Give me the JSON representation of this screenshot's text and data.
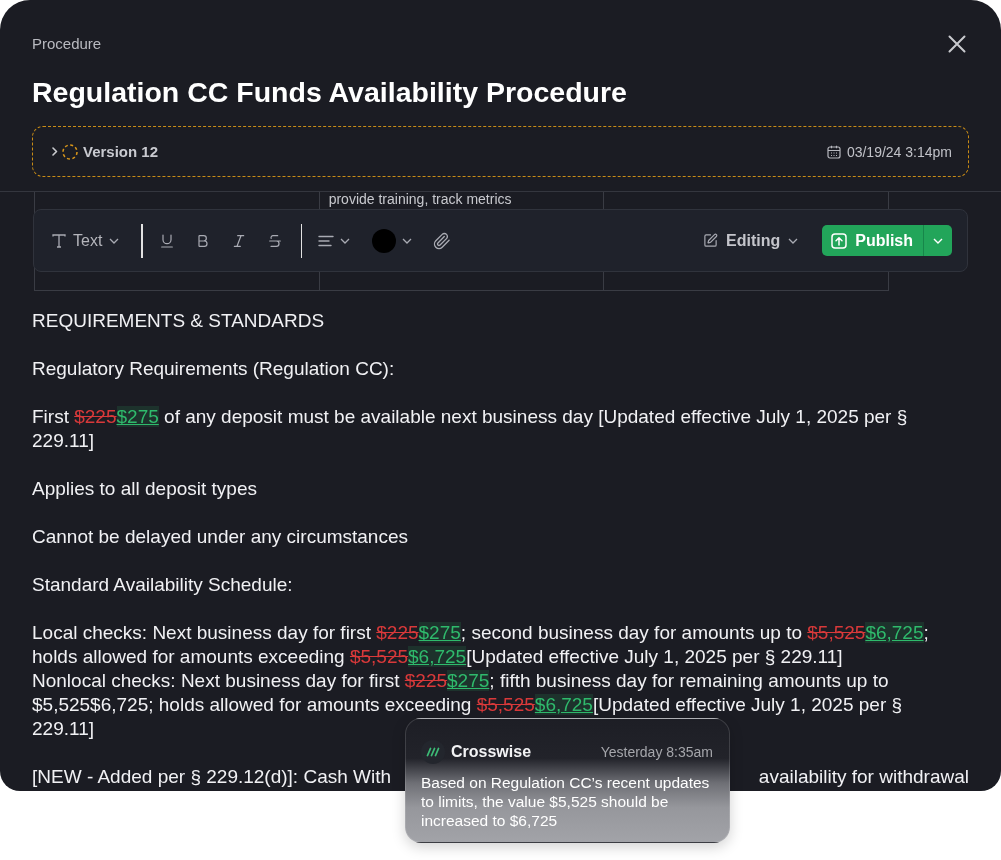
{
  "header": {
    "label": "Procedure",
    "title": "Regulation CC Funds Availability Procedure"
  },
  "version": {
    "label": "Version 12",
    "date": "03/19/24 3:14pm",
    "expanded": false
  },
  "table_fragment": {
    "cell_text": "provide training, track metrics"
  },
  "toolbar": {
    "text_style": "Text",
    "mode": "Editing",
    "publish": "Publish"
  },
  "document": [
    {
      "kind": "block",
      "lines": [
        {
          "segments": [
            {
              "kind": "text",
              "text": "REQUIREMENTS & STANDARDS"
            }
          ]
        }
      ]
    },
    {
      "kind": "block",
      "lines": [
        {
          "segments": [
            {
              "kind": "text",
              "text": "Regulatory Requirements (Regulation CC):"
            }
          ]
        }
      ]
    },
    {
      "kind": "block",
      "lines": [
        {
          "segments": [
            {
              "kind": "text",
              "text": "First "
            },
            {
              "kind": "deleted",
              "text": "$225"
            },
            {
              "kind": "inserted",
              "text": "$275"
            },
            {
              "kind": "text",
              "text": " of any deposit must be available next business day [Updated effective July 1, 2025 per § 229.11]"
            }
          ]
        }
      ]
    },
    {
      "kind": "block",
      "lines": [
        {
          "segments": [
            {
              "kind": "text",
              "text": "Applies to all deposit types"
            }
          ]
        }
      ]
    },
    {
      "kind": "block",
      "lines": [
        {
          "segments": [
            {
              "kind": "text",
              "text": "Cannot be delayed under any circumstances"
            }
          ]
        }
      ]
    },
    {
      "kind": "block",
      "lines": [
        {
          "segments": [
            {
              "kind": "text",
              "text": "Standard Availability Schedule:"
            }
          ]
        }
      ]
    },
    {
      "kind": "block",
      "lines": [
        {
          "segments": [
            {
              "kind": "text",
              "text": "Local checks: Next business day for first "
            },
            {
              "kind": "deleted",
              "text": "$225"
            },
            {
              "kind": "inserted",
              "text": "$275"
            },
            {
              "kind": "text",
              "text": "; second business day for amounts up to "
            },
            {
              "kind": "deleted",
              "text": "$5,525"
            },
            {
              "kind": "inserted",
              "text": "$6,725"
            },
            {
              "kind": "text",
              "text": "; holds allowed for amounts exceeding "
            },
            {
              "kind": "deleted",
              "text": "$5,525"
            },
            {
              "kind": "inserted",
              "text": "$6,725"
            },
            {
              "kind": "text",
              "text": "[Updated effective July 1, 2025 per § 229.11]"
            }
          ]
        },
        {
          "segments": [
            {
              "kind": "text",
              "text": "Nonlocal checks: Next business day for first "
            },
            {
              "kind": "deleted",
              "text": "$225"
            },
            {
              "kind": "inserted",
              "text": "$275"
            },
            {
              "kind": "text",
              "text": "; fifth business day for remaining amounts up to $5,525$6,725; holds allowed for amounts exceeding "
            },
            {
              "kind": "deleted",
              "text": "$5,525"
            },
            {
              "kind": "inserted",
              "text": "$6,725"
            },
            {
              "kind": "text",
              "text": "[Updated effective July 1, 2025 per § 229.11]"
            }
          ]
        }
      ]
    },
    {
      "kind": "covered",
      "visible_start": "[NEW - Added per § 229.12(d)]: Cash With",
      "visible_end": "availability for withdrawal"
    }
  ],
  "notification": {
    "app": "Crosswise",
    "time": "Yesterday 8:35am",
    "message": "Based on Regulation CC’s recent updates to limits, the value $5,525 should be increased to $6,725"
  }
}
